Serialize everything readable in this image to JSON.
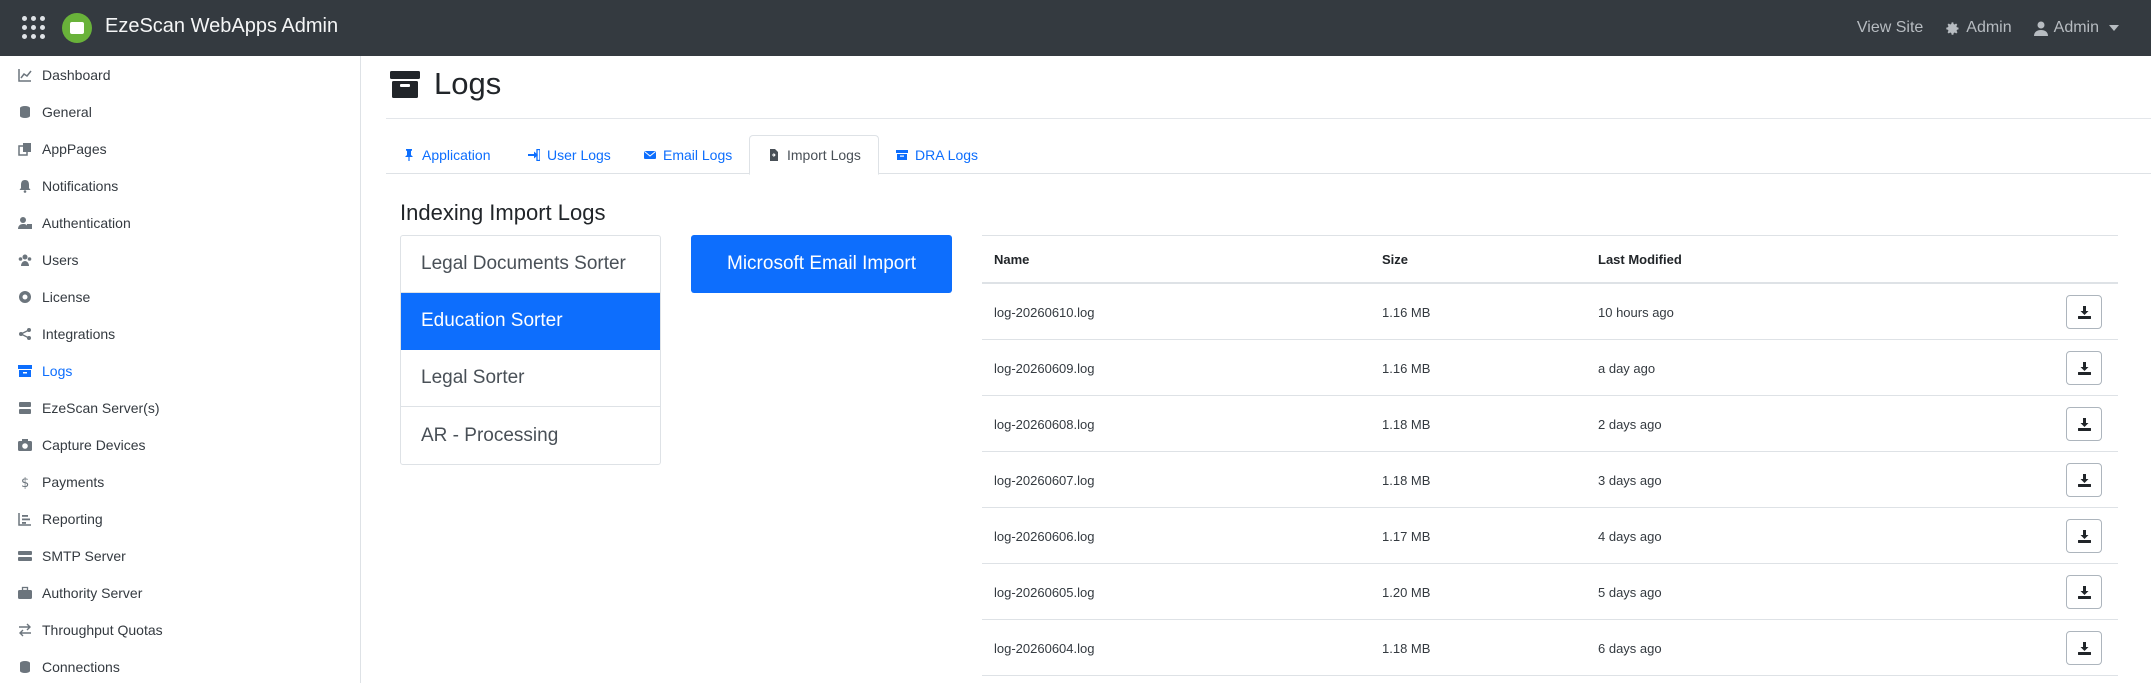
{
  "topbar": {
    "brand": "EzeScan WebApps Admin",
    "view_site": "View Site",
    "admin_settings": "Admin",
    "user_menu": "Admin"
  },
  "sidebar": {
    "items": [
      {
        "label": "Dashboard",
        "icon": "chart-line-icon"
      },
      {
        "label": "General",
        "icon": "database-icon"
      },
      {
        "label": "AppPages",
        "icon": "copy-icon"
      },
      {
        "label": "Notifications",
        "icon": "bell-icon"
      },
      {
        "label": "Authentication",
        "icon": "user-lock-icon"
      },
      {
        "label": "Users",
        "icon": "users-icon"
      },
      {
        "label": "License",
        "icon": "certificate-icon"
      },
      {
        "label": "Integrations",
        "icon": "share-icon"
      },
      {
        "label": "Logs",
        "icon": "archive-icon",
        "active": true
      },
      {
        "label": "EzeScan Server(s)",
        "icon": "server-icon"
      },
      {
        "label": "Capture Devices",
        "icon": "camera-icon"
      },
      {
        "label": "Payments",
        "icon": "dollar-icon"
      },
      {
        "label": "Reporting",
        "icon": "chart-bar-icon"
      },
      {
        "label": "SMTP Server",
        "icon": "mail-server-icon"
      },
      {
        "label": "Authority Server",
        "icon": "briefcase-icon"
      },
      {
        "label": "Throughput Quotas",
        "icon": "exchange-icon"
      },
      {
        "label": "Connections",
        "icon": "database-icon"
      }
    ]
  },
  "page": {
    "title": "Logs",
    "tabs": [
      {
        "label": "Application"
      },
      {
        "label": "User Logs"
      },
      {
        "label": "Email Logs"
      },
      {
        "label": "Import Logs",
        "active": true
      },
      {
        "label": "DRA Logs"
      }
    ],
    "section_title": "Indexing Import Logs",
    "sorters": [
      {
        "label": "Legal Documents Sorter"
      },
      {
        "label": "Education Sorter",
        "active": true
      },
      {
        "label": "Legal Sorter"
      },
      {
        "label": "AR - Processing"
      }
    ],
    "email_import_button": "Microsoft Email Import"
  },
  "table": {
    "headers": {
      "name": "Name",
      "size": "Size",
      "modified": "Last Modified"
    },
    "rows": [
      {
        "name": "log-20260610.log",
        "size": "1.16 MB",
        "modified": "10 hours ago"
      },
      {
        "name": "log-20260609.log",
        "size": "1.16 MB",
        "modified": "a day ago"
      },
      {
        "name": "log-20260608.log",
        "size": "1.18 MB",
        "modified": "2 days ago"
      },
      {
        "name": "log-20260607.log",
        "size": "1.18 MB",
        "modified": "3 days ago"
      },
      {
        "name": "log-20260606.log",
        "size": "1.17 MB",
        "modified": "4 days ago"
      },
      {
        "name": "log-20260605.log",
        "size": "1.20 MB",
        "modified": "5 days ago"
      },
      {
        "name": "log-20260604.log",
        "size": "1.18 MB",
        "modified": "6 days ago"
      }
    ]
  },
  "colors": {
    "topbar": "#343a40",
    "accent": "#0d6efd",
    "logo": "#69b23a"
  }
}
